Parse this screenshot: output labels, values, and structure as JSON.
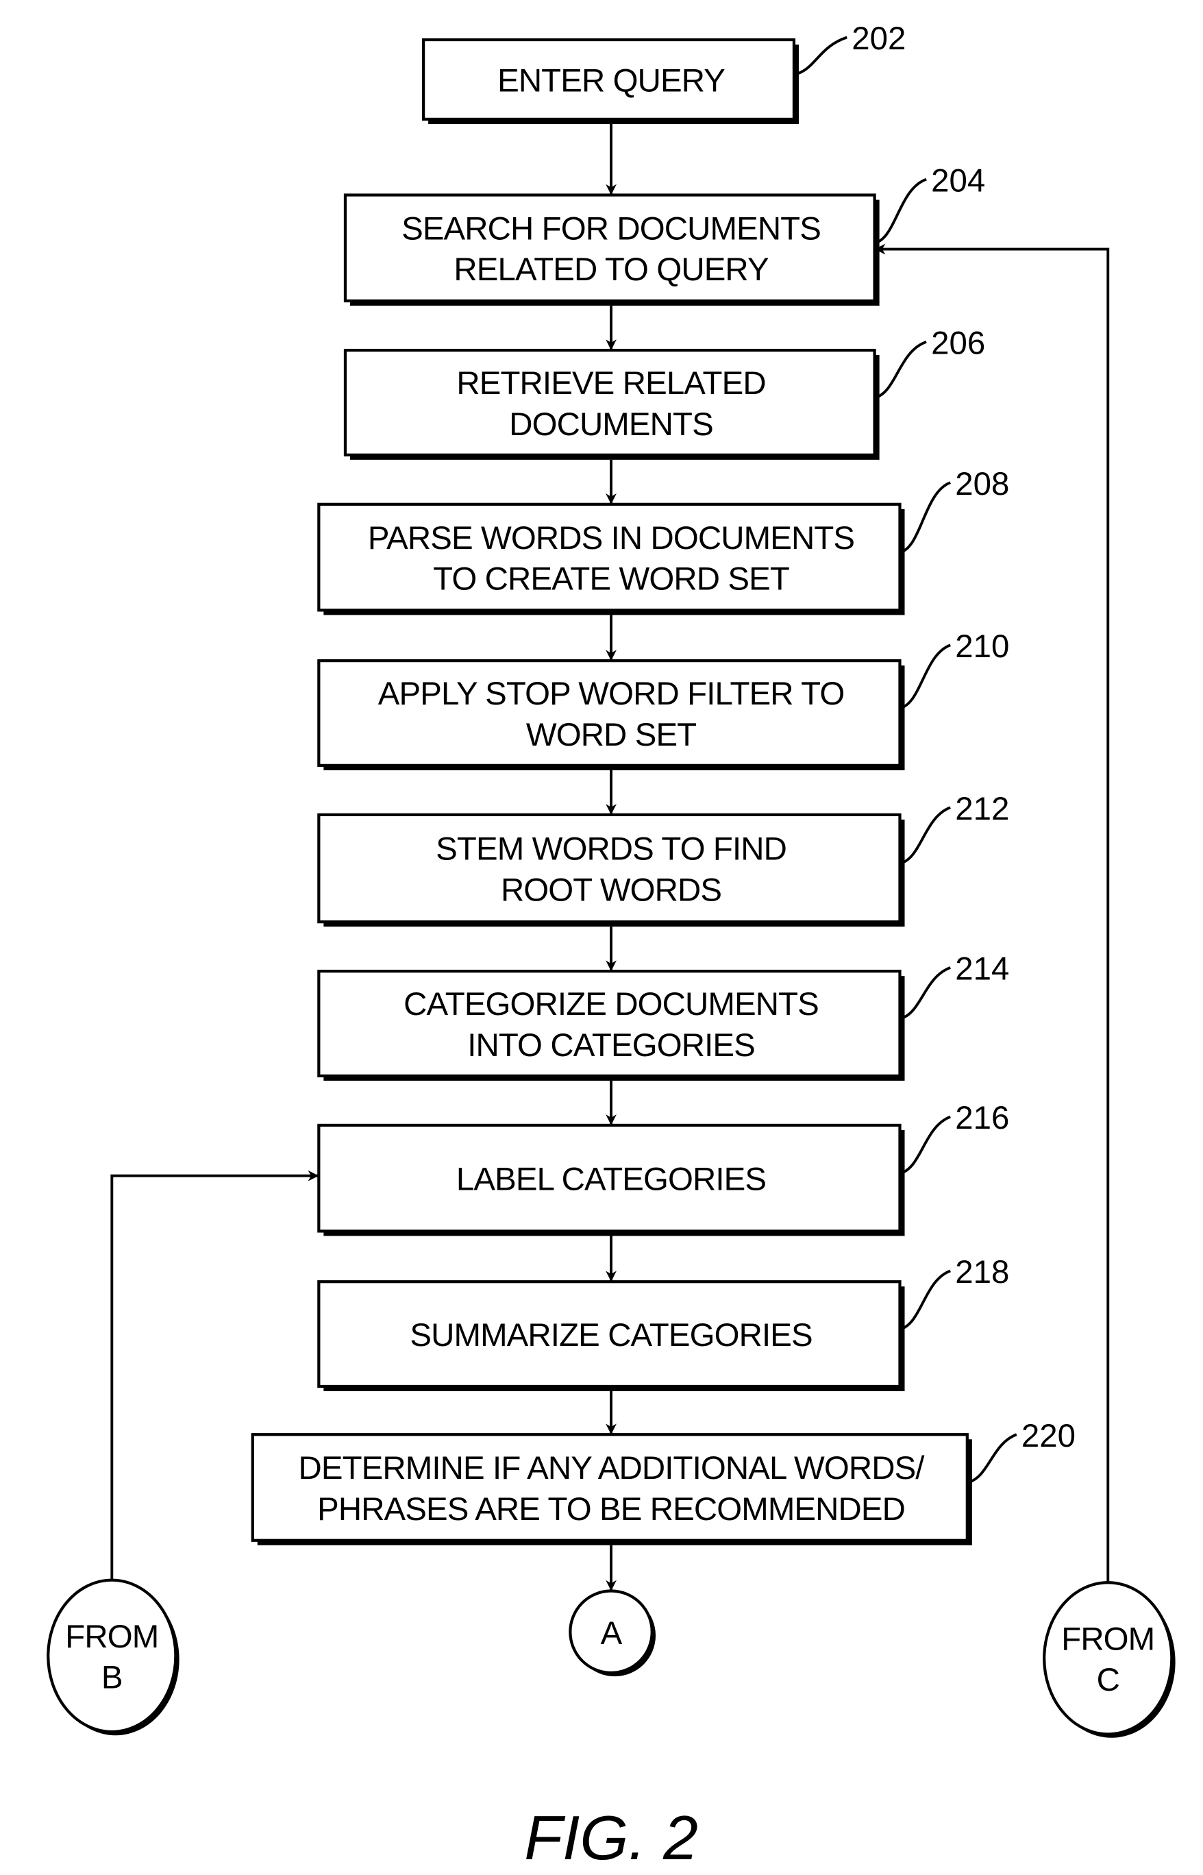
{
  "figure_label": "FIG. 2",
  "steps": [
    {
      "id": "202",
      "lines": [
        "ENTER QUERY"
      ]
    },
    {
      "id": "204",
      "lines": [
        "SEARCH FOR DOCUMENTS",
        "RELATED TO QUERY"
      ]
    },
    {
      "id": "206",
      "lines": [
        "RETRIEVE RELATED",
        "DOCUMENTS"
      ]
    },
    {
      "id": "208",
      "lines": [
        "PARSE WORDS IN DOCUMENTS",
        "TO CREATE WORD SET"
      ]
    },
    {
      "id": "210",
      "lines": [
        "APPLY STOP WORD FILTER TO",
        "WORD SET"
      ]
    },
    {
      "id": "212",
      "lines": [
        "STEM WORDS TO FIND",
        "ROOT WORDS"
      ]
    },
    {
      "id": "214",
      "lines": [
        "CATEGORIZE DOCUMENTS",
        "INTO CATEGORIES"
      ]
    },
    {
      "id": "216",
      "lines": [
        "LABEL CATEGORIES"
      ]
    },
    {
      "id": "218",
      "lines": [
        "SUMMARIZE CATEGORIES"
      ]
    },
    {
      "id": "220",
      "lines": [
        "DETERMINE IF ANY ADDITIONAL WORDS/",
        "PHRASES ARE TO BE RECOMMENDED"
      ]
    }
  ],
  "connectors": {
    "to_a": {
      "lines": [
        "A"
      ]
    },
    "from_b": {
      "lines": [
        "FROM",
        "B"
      ],
      "target_step": "216"
    },
    "from_c": {
      "lines": [
        "FROM",
        "C"
      ],
      "target_step": "204"
    }
  }
}
